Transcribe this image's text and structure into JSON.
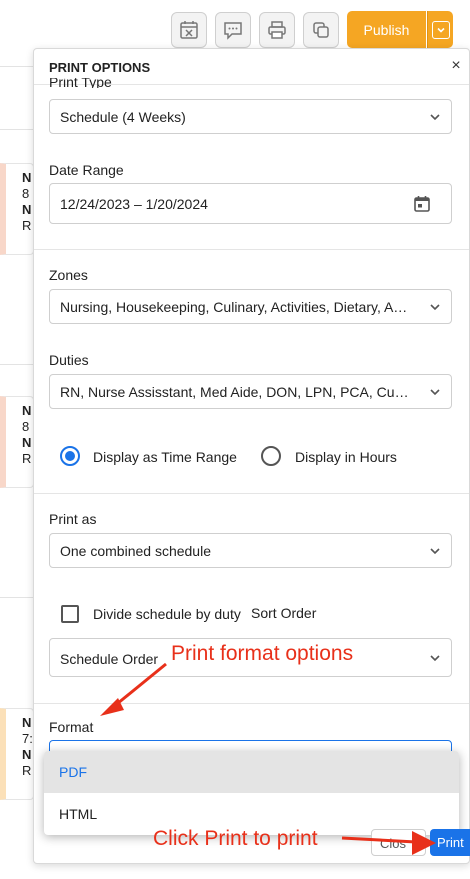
{
  "toolbar": {
    "icons": [
      "calendar-x-icon",
      "chat-icon",
      "printer-icon",
      "copy-icon"
    ],
    "publish_label": "Publish",
    "accent": "#f5a623"
  },
  "background_cards": [
    {
      "l1": "N",
      "l2": "8",
      "l3": "N",
      "l4": "R"
    },
    {
      "l1": "N",
      "l2": "8",
      "l3": "N",
      "l4": "R"
    },
    {
      "l1": "N",
      "l2": "7:",
      "l3": "N",
      "l4": "R"
    }
  ],
  "modal": {
    "title": "PRINT OPTIONS",
    "close_symbol": "×",
    "print_type": {
      "label": "Print Type",
      "value": "Schedule (4 Weeks)"
    },
    "date_range": {
      "label": "Date Range",
      "value": "12/24/2023 – 1/20/2024"
    },
    "zones": {
      "label": "Zones",
      "value": "Nursing, Housekeeping, Culinary, Activities, Dietary, Ad..."
    },
    "duties": {
      "label": "Duties",
      "value": "RN, Nurse Assisstant, Med Aide, DON, LPN, PCA, Culinar..."
    },
    "display_options": [
      {
        "label": "Display as Time Range",
        "selected": true
      },
      {
        "label": "Display in Hours",
        "selected": false
      }
    ],
    "print_as": {
      "label": "Print as",
      "value": "One combined schedule"
    },
    "divide_checkbox": {
      "label": "Divide schedule by duty",
      "checked": false
    },
    "sort_order": {
      "label": "Sort Order",
      "value": "Schedule Order"
    },
    "format": {
      "label": "Format",
      "options": [
        "PDF",
        "HTML"
      ],
      "highlighted": "PDF"
    },
    "close_button": "Clos",
    "print_button": "Print"
  },
  "annotations": {
    "format_hint": "Print format options",
    "print_hint": "Click Print to print",
    "color": "#e8301a"
  },
  "colors": {
    "primary": "#1a73e8",
    "publish": "#f5a623"
  }
}
